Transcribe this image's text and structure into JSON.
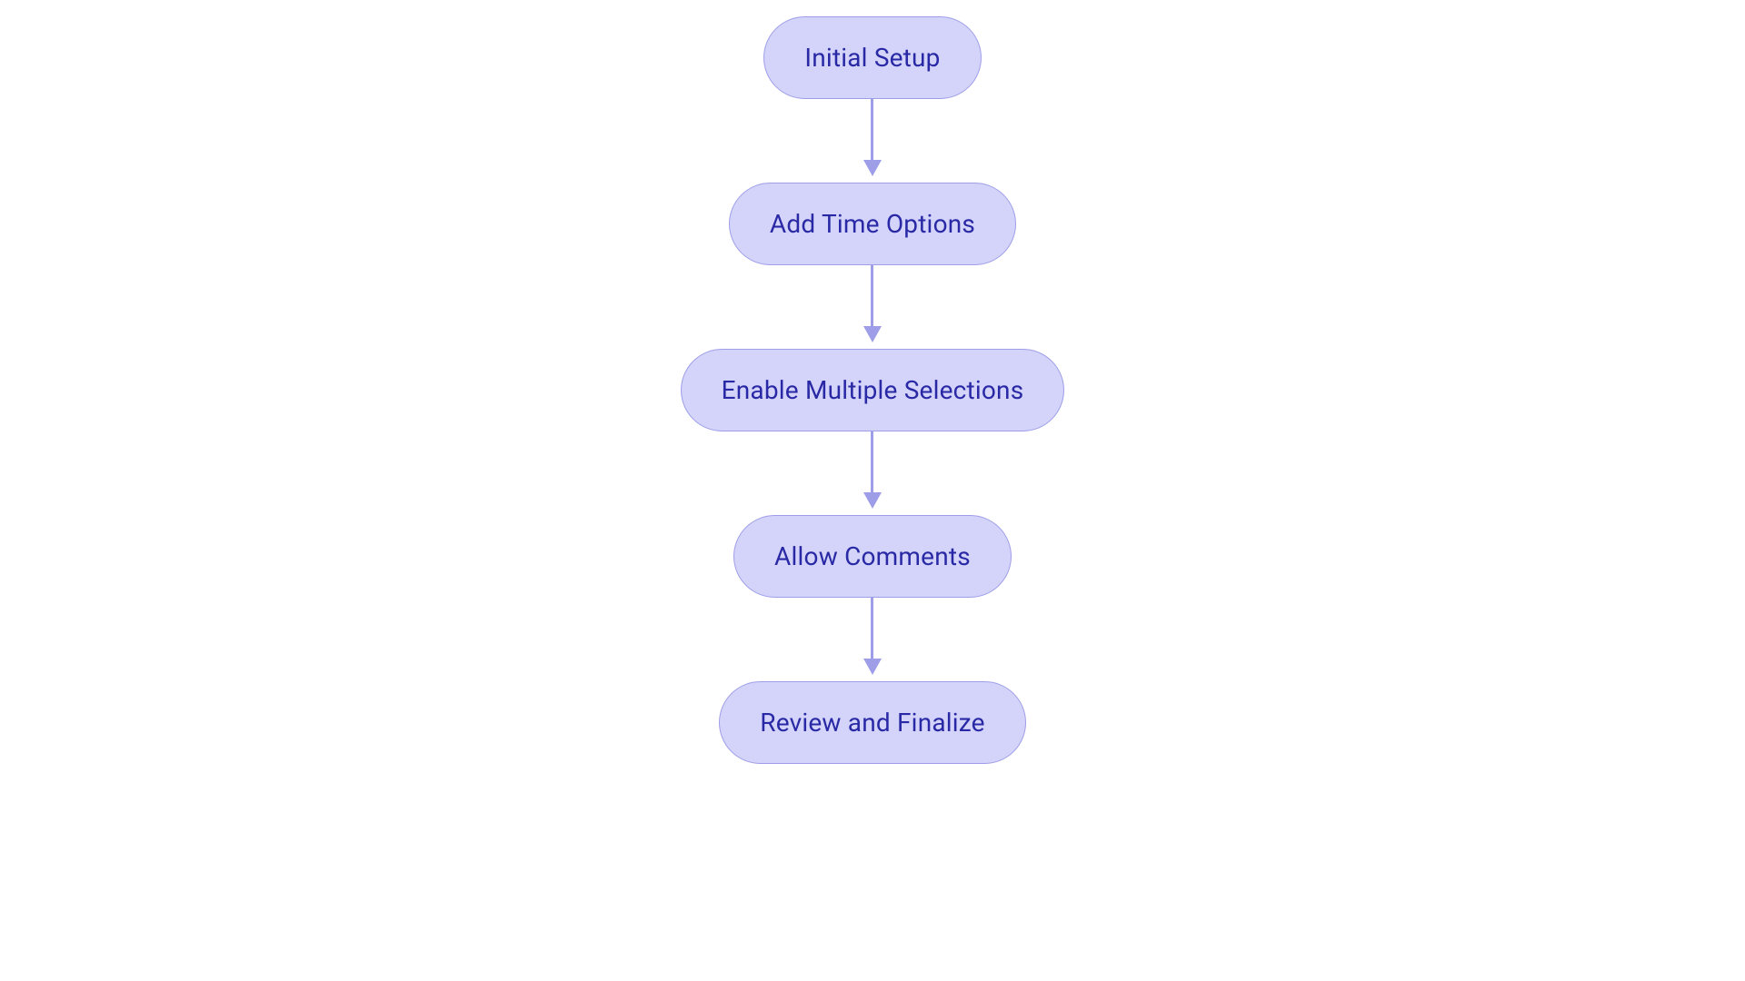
{
  "diagram": {
    "nodes": [
      {
        "id": "initial-setup",
        "label": "Initial Setup"
      },
      {
        "id": "add-time-options",
        "label": "Add Time Options"
      },
      {
        "id": "enable-multiple-selections",
        "label": "Enable Multiple Selections"
      },
      {
        "id": "allow-comments",
        "label": "Allow Comments"
      },
      {
        "id": "review-and-finalize",
        "label": "Review and Finalize"
      }
    ],
    "edges": [
      {
        "from": "initial-setup",
        "to": "add-time-options"
      },
      {
        "from": "add-time-options",
        "to": "enable-multiple-selections"
      },
      {
        "from": "enable-multiple-selections",
        "to": "allow-comments"
      },
      {
        "from": "allow-comments",
        "to": "review-and-finalize"
      }
    ],
    "colors": {
      "node_fill": "#d4d4fb",
      "node_border": "#9e9ee8",
      "node_text": "#2929a6",
      "arrow": "#9e9ee8"
    }
  }
}
